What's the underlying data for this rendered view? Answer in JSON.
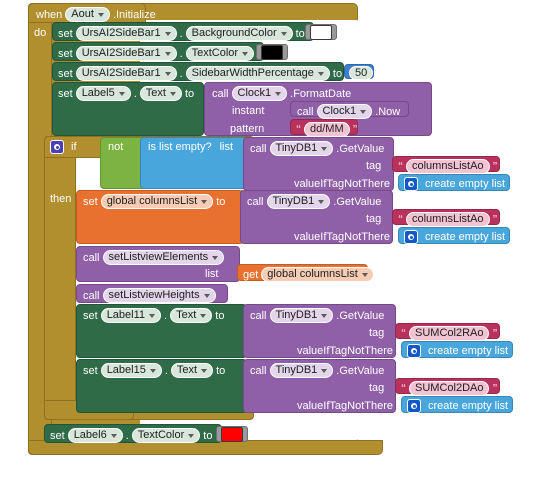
{
  "app": {
    "title": "MIT App Inventor Blocks Editor",
    "canvas_background": "#ffffff"
  },
  "palette": {
    "event_block": "#b18e2e",
    "control_block": "#b18e2e",
    "setter_block": "#2e6b46",
    "procedure_call_block": "#8f5fa8",
    "logic_block": "#7cb342",
    "list_block": "#49a6dd",
    "text_block": "#b8325d",
    "variable_block": "#e8712f",
    "math_block": "#3d7fd1"
  },
  "event": {
    "when_label": "when",
    "component": "Aout",
    "event_name": ".Initialize",
    "do_label": "do"
  },
  "statements": {
    "set_label": "set",
    "to_label": "to",
    "call_label": "call",
    "get_label": "get",
    "dot": ".",
    "if_label": "if",
    "then_label": "then",
    "not_label": "not",
    "is_list_empty_label": "is list empty?",
    "list_socket_label": "list",
    "create_empty_list_label": "create empty list",
    "instant_label": "instant",
    "pattern_label": "pattern",
    "tag_label": "tag",
    "value_if_tag_not_there_label": "valueIfTagNotThere"
  },
  "rows": {
    "set_bgcolor": {
      "component": "UrsAI2SideBar1",
      "property": "BackgroundColor",
      "value_color": "#ffffff"
    },
    "set_textcolor": {
      "component": "UrsAI2SideBar1",
      "property": "TextColor",
      "value_color": "#000000"
    },
    "set_sidebarwidth": {
      "component": "UrsAI2SideBar1",
      "property": "SidebarWidthPercentage",
      "value_number": "50"
    },
    "set_label5_text": {
      "component": "Label5",
      "property": "Text",
      "call_component": "Clock1",
      "call_method": ".FormatDate",
      "instant_call_component": "Clock1",
      "instant_call_method": ".Now",
      "pattern_text": "dd/MM"
    },
    "if_condition": {
      "getvalue_component": "TinyDB1",
      "getvalue_method": ".GetValue",
      "tag_text": "columnsListAo"
    },
    "set_global_columnslist": {
      "variable": "global columnsList",
      "getvalue_component": "TinyDB1",
      "getvalue_method": ".GetValue",
      "tag_text": "columnsListAo"
    },
    "call_set_listview_elements": {
      "procedure": "setListviewElements",
      "arg_label": "list",
      "arg_variable": "global columnsList"
    },
    "call_set_listview_heights": {
      "procedure": "setListviewHeights"
    },
    "set_label11_text": {
      "component": "Label11",
      "property": "Text",
      "getvalue_component": "TinyDB1",
      "getvalue_method": ".GetValue",
      "tag_text": "SUMCol2RAo"
    },
    "set_label15_text": {
      "component": "Label15",
      "property": "Text",
      "getvalue_component": "TinyDB1",
      "getvalue_method": ".GetValue",
      "tag_text": "SUMCol2DAo"
    },
    "set_label6_textcolor": {
      "component": "Label6",
      "property": "TextColor",
      "value_color": "#ff0000"
    }
  }
}
